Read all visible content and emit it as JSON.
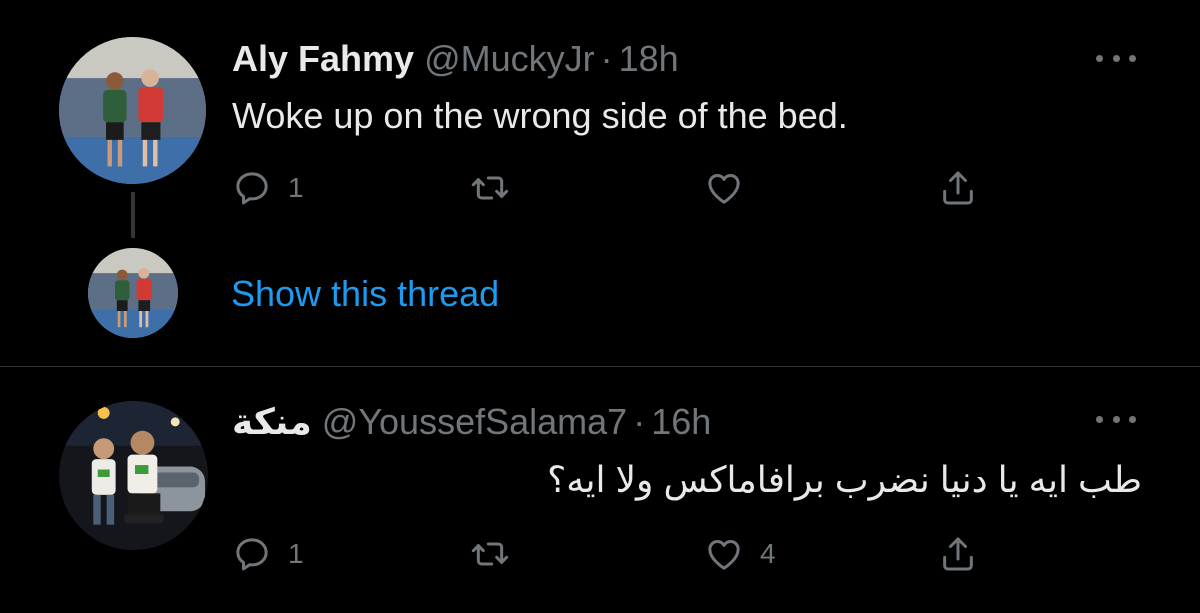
{
  "tweets": [
    {
      "name": "Aly Fahmy",
      "handle": "@MuckyJr",
      "separator": "·",
      "time": "18h",
      "text": "Woke up on the wrong side of the bed.",
      "reply_count": "1",
      "retweet_count": "",
      "like_count": ""
    },
    {
      "name": "منكة",
      "handle": "@YoussefSalama7",
      "separator": "·",
      "time": "16h",
      "text": "طب ايه يا دنيا نضرب برافاماكس ولا ايه؟",
      "reply_count": "1",
      "retweet_count": "",
      "like_count": "4"
    }
  ],
  "thread": {
    "show_label": "Show this thread"
  },
  "colors": {
    "background": "#000000",
    "text": "#e7e9ea",
    "muted": "#71767b",
    "link": "#1d9bf0",
    "divider": "#2f3336"
  },
  "icons": [
    "reply-icon",
    "retweet-icon",
    "like-icon",
    "share-icon",
    "more-icon"
  ]
}
